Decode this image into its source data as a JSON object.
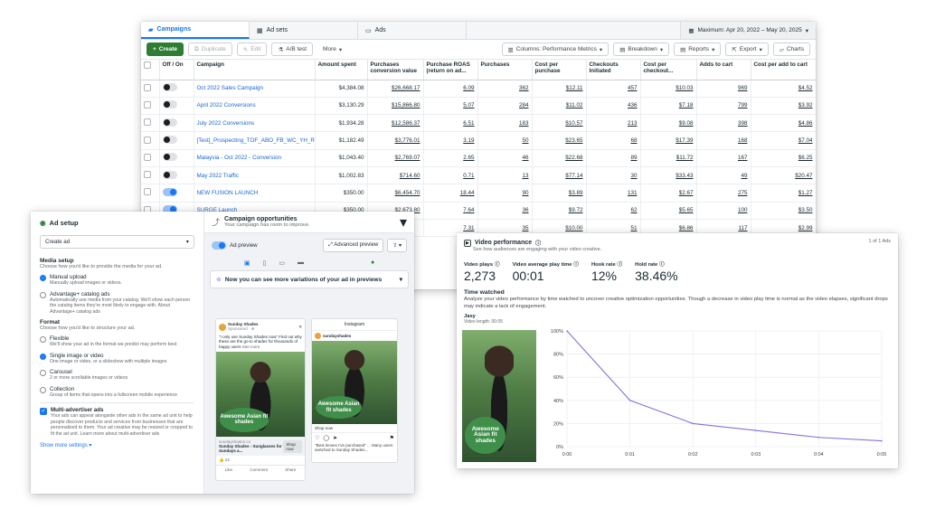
{
  "table": {
    "tabs": [
      {
        "label": "Campaigns",
        "icon": "folder-icon"
      },
      {
        "label": "Ad sets",
        "icon": "grid-icon"
      },
      {
        "label": "Ads",
        "icon": "document-icon"
      }
    ],
    "date_range": "Maximum: Apr 20, 2022 – May 20, 2025",
    "toolbar": {
      "create": "Create",
      "duplicate": "Duplicate",
      "edit": "Edit",
      "ab_test": "A/B test",
      "more": "More",
      "columns": "Columns: Performance Metrics",
      "breakdown": "Breakdown",
      "reports": "Reports",
      "export": "Export",
      "charts": "Charts"
    },
    "columns": [
      "Off / On",
      "Campaign",
      "Amount spent",
      "Purchases conversion value",
      "Purchase ROAS (return on ad...",
      "Purchases",
      "Cost per purchase",
      "Checkouts Initiated",
      "Cost per checkout...",
      "Adds to cart",
      "Cost per add to cart"
    ],
    "rows": [
      {
        "on": false,
        "name": "Oct 2022 Sales Campaign",
        "spent": "$4,384.08",
        "value": "$26,668.17",
        "roas": "6.09",
        "purchases": "362",
        "cpp": "$12.11",
        "checkouts": "457",
        "cpc": "$10.03",
        "atc": "969",
        "cpa": "$4.52"
      },
      {
        "on": false,
        "name": "April 2022 Conversions",
        "spent": "$3,130.29",
        "value": "$15,866.80",
        "roas": "5.07",
        "purchases": "284",
        "cpp": "$11.02",
        "checkouts": "436",
        "cpc": "$7.18",
        "atc": "799",
        "cpa": "$3.92"
      },
      {
        "on": false,
        "name": "July 2022 Conversions",
        "spent": "$1,934.28",
        "value": "$12,586.37",
        "roas": "6.51",
        "purchases": "183",
        "cpp": "$10.57",
        "checkouts": "213",
        "cpc": "$9.08",
        "atc": "398",
        "cpa": "$4.86"
      },
      {
        "on": false,
        "name": "[Test]_Prospecting_TOF_ABO_FB_WC_YH_RP",
        "spent": "$1,182.49",
        "value": "$3,776.01",
        "roas": "3.19",
        "purchases": "50",
        "cpp": "$23.65",
        "checkouts": "68",
        "cpc": "$17.39",
        "atc": "168",
        "cpa": "$7.04"
      },
      {
        "on": false,
        "name": "Malaysia - Oct 2022 - Conversion",
        "spent": "$1,043.40",
        "value": "$2,769.07",
        "roas": "2.65",
        "purchases": "46",
        "cpp": "$22.68",
        "checkouts": "89",
        "cpc": "$11.72",
        "atc": "167",
        "cpa": "$6.25"
      },
      {
        "on": false,
        "name": "May 2022 Traffic",
        "spent": "$1,002.83",
        "value": "$714.60",
        "roas": "0.71",
        "purchases": "13",
        "cpp": "$77.14",
        "checkouts": "30",
        "cpc": "$33.43",
        "atc": "49",
        "cpa": "$20.47"
      },
      {
        "on": true,
        "name": "NEW FUSION LAUNCH",
        "spent": "$350.00",
        "value": "$6,454.70",
        "roas": "18.44",
        "purchases": "90",
        "cpp": "$3.89",
        "checkouts": "131",
        "cpc": "$2.67",
        "atc": "275",
        "cpa": "$1.27"
      },
      {
        "on": true,
        "name": "SURGE Launch",
        "spent": "$350.00",
        "value": "$2,673.80",
        "roas": "7.64",
        "purchases": "36",
        "cpp": "$9.72",
        "checkouts": "62",
        "cpc": "$5.65",
        "atc": "100",
        "cpa": "$3.50"
      },
      {
        "on": false,
        "name": "",
        "spent": "",
        "value": "",
        "roas": "7.31",
        "purchases": "35",
        "cpp": "$10.00",
        "checkouts": "51",
        "cpc": "$6.86",
        "atc": "117",
        "cpa": "$2.99"
      }
    ]
  },
  "setup": {
    "title": "Ad setup",
    "create_select": "Create ad",
    "media_heading": "Media setup",
    "media_sub": "Choose how you'd like to provide the media for your ad.",
    "manual_name": "Manual upload",
    "manual_desc": "Manually upload images or videos.",
    "advantage_name": "Advantage+ catalog ads",
    "advantage_desc": "Automatically use media from your catalog. We'll show each person the catalog items they're most likely to engage with. About Advantage+ catalog ads",
    "format_heading": "Format",
    "format_sub": "Choose how you'd like to structure your ad.",
    "formats": [
      {
        "name": "Flexible",
        "desc": "We'll show your ad in the format we predict may perform best",
        "selected": false
      },
      {
        "name": "Single image or video",
        "desc": "One image or video, or a slideshow with multiple images",
        "selected": true
      },
      {
        "name": "Carousel",
        "desc": "2 or more scrollable images or videos",
        "selected": false
      },
      {
        "name": "Collection",
        "desc": "Group of items that opens into a fullscreen mobile experience",
        "selected": false
      }
    ],
    "multi_name": "Multi-advertiser ads",
    "multi_desc": "Your ads can appear alongside other ads in the same ad unit to help people discover products and services from businesses that are personalized to them. Your ad creative may be resized or cropped to fit the ad unit. Learn more about multi-advertiser ads",
    "show_more": "Show more settings ▾",
    "opp_title": "Campaign opportunities",
    "opp_sub": "Your campaign has room to improve.",
    "ad_preview": "Ad preview",
    "advanced_preview": "Advanced preview",
    "banner": "Now you can see more variations of your ad in previews",
    "fb_page": "Sunday Shades",
    "fb_sponsored": "Sponsored · ⊕",
    "fb_caption": "\"I only use Sunday Shades now\" Find out why these are the go-to shades for thousands of happy users",
    "fb_see_more": "See more",
    "fb_url": "sundayshades.co",
    "fb_headline": "Sunday Shades - Sunglasses for Sundays a...",
    "fb_shop": "Shop now",
    "fb_likes": "22",
    "fb_actions": [
      "Like",
      "Comment",
      "Share"
    ],
    "ig_title": "Instagram",
    "ig_handle": "sundayshades",
    "ig_shop": "Shop now",
    "ig_caption": "\"Best lenses I've purchased\" ... Many users switched to Sunday Shades...",
    "badge_text": "Awesome Asian fit shades"
  },
  "video": {
    "title": "Video performance",
    "subtitle": "See how audiences are engaging with your video creative.",
    "count": "1 of 1 Ads",
    "metrics": [
      {
        "label": "Video plays",
        "value": "2,273"
      },
      {
        "label": "Video average play time",
        "value": "00:01"
      },
      {
        "label": "Hook rate",
        "value": "12%"
      },
      {
        "label": "Hold rate",
        "value": "38.46%"
      }
    ],
    "time_heading": "Time watched",
    "time_desc": "Analyze your video performance by time watched to uncover creative optimization opportunities. Though a decrease in video play time is normal as the video elapses, significant drops may indicate a lack of engagement.",
    "video_name": "Jaxy",
    "video_length": "Video length: 00:05",
    "badge_text": "Awesome Asian fit shades"
  },
  "chart_data": {
    "type": "line",
    "x": [
      "0:00",
      "0:01",
      "0:02",
      "0:03",
      "0:04",
      "0:05"
    ],
    "series": [
      {
        "values": [
          100,
          40,
          20,
          14,
          8,
          5
        ]
      }
    ],
    "y_ticks": [
      "100%",
      "80%",
      "60%",
      "40%",
      "20%",
      "0%"
    ],
    "ylim": [
      0,
      100
    ],
    "color": "#8a6fd8"
  }
}
